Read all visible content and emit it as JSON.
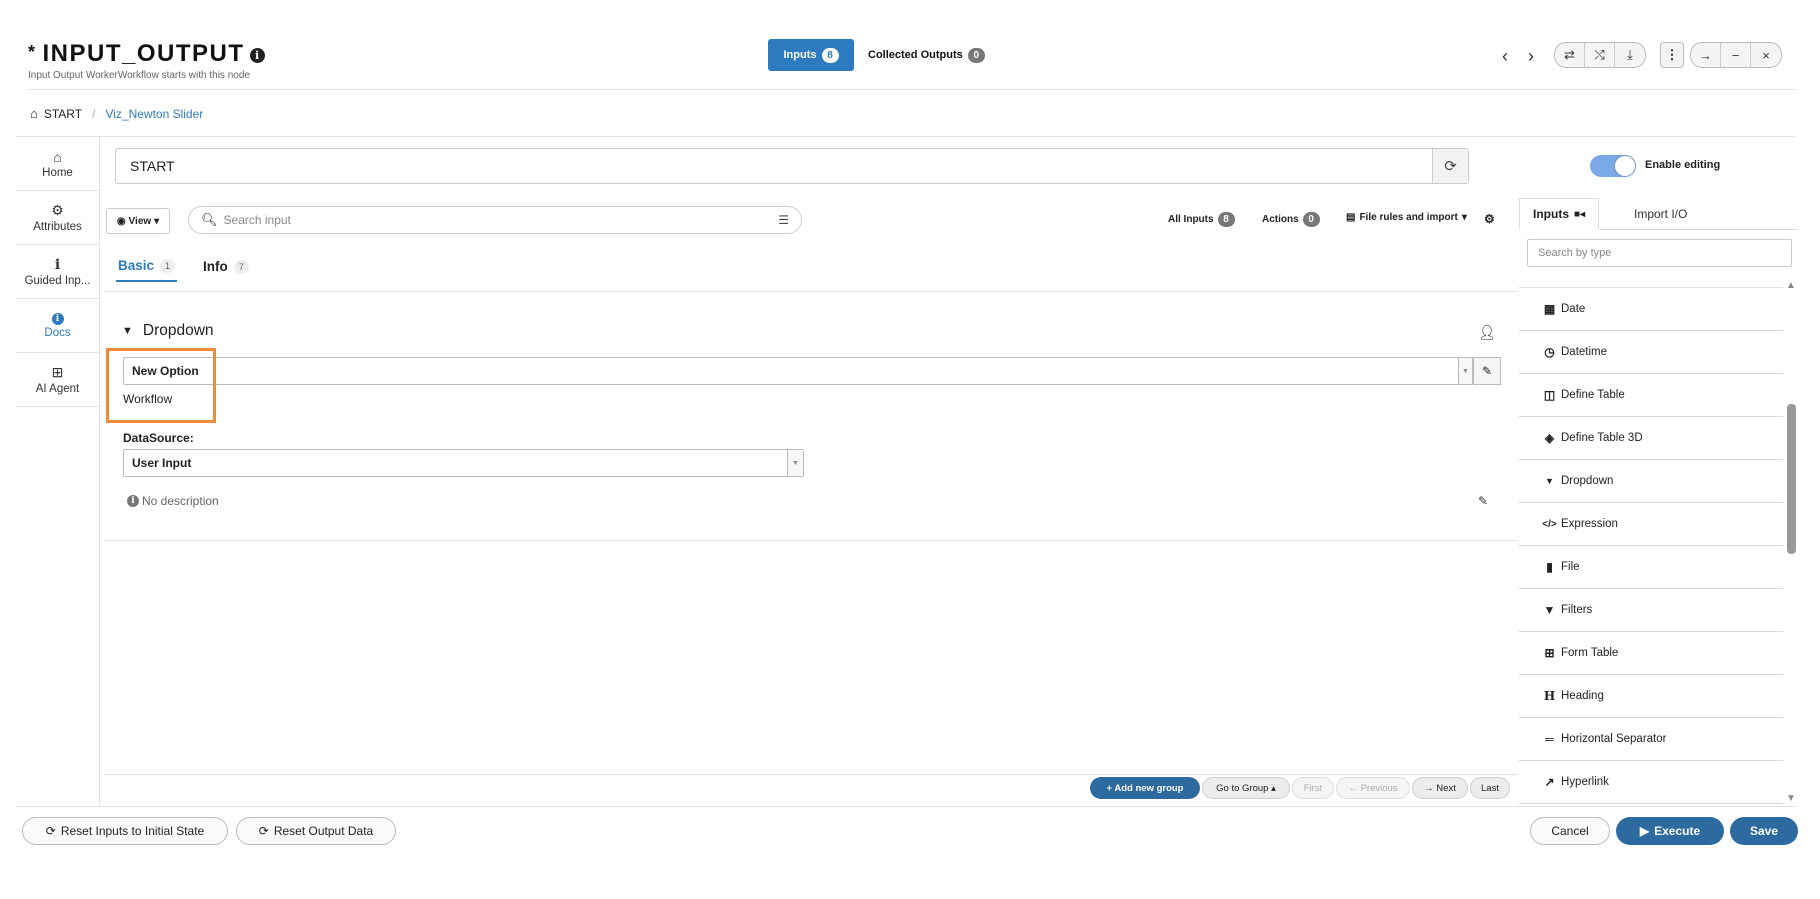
{
  "header": {
    "title": "INPUT_OUTPUT",
    "title_prefix": "*",
    "subtitle": "Input Output WorkerWorkflow starts with this node",
    "tabs": [
      {
        "label": "Inputs",
        "count": "8"
      },
      {
        "label": "Collected Outputs",
        "count": "0"
      }
    ]
  },
  "breadcrumb": {
    "root": "START",
    "current": "Viz_Newton Slider"
  },
  "left_nav": [
    {
      "label": "Home",
      "icon": "home-icon"
    },
    {
      "label": "Attributes",
      "icon": "gear-icon"
    },
    {
      "label": "Guided Inp...",
      "icon": "info-icon"
    },
    {
      "label": "Docs",
      "icon": "info-circle-icon",
      "active": true
    },
    {
      "label": "AI Agent",
      "icon": "robot-icon"
    }
  ],
  "main": {
    "start_value": "START",
    "view_label": "View",
    "search_placeholder": "Search input",
    "all_inputs_label": "All Inputs",
    "all_inputs_count": "8",
    "actions_label": "Actions",
    "actions_count": "0",
    "file_rules_label": "File rules and import",
    "subtabs": [
      {
        "label": "Basic",
        "count": "1",
        "active": true
      },
      {
        "label": "Info",
        "count": "7"
      }
    ],
    "group_title": "Dropdown",
    "dropdown_value": "New Option",
    "dropdown_sub_label": "Workflow",
    "datasource_label": "DataSource:",
    "datasource_value": "User Input",
    "no_description": "No description"
  },
  "pagination": {
    "add_group": "+ Add new group",
    "go_to_group": "Go to Group",
    "first": "First",
    "previous": "← Previous",
    "next": "→ Next",
    "last": "Last"
  },
  "right_panel": {
    "enable_editing_label": "Enable editing",
    "tabs": [
      {
        "label": "Inputs",
        "active": true
      },
      {
        "label": "Import I/O"
      }
    ],
    "search_placeholder": "Search by type",
    "types": [
      {
        "label": "Date",
        "icon": "calendar-icon"
      },
      {
        "label": "Datetime",
        "icon": "clock-icon"
      },
      {
        "label": "Define Table",
        "icon": "table-columns-icon"
      },
      {
        "label": "Define Table 3D",
        "icon": "cube-icon"
      },
      {
        "label": "Dropdown",
        "icon": "caret-down-icon"
      },
      {
        "label": "Expression",
        "icon": "code-icon"
      },
      {
        "label": "File",
        "icon": "file-icon"
      },
      {
        "label": "Filters",
        "icon": "filter-icon"
      },
      {
        "label": "Form Table",
        "icon": "table-icon"
      },
      {
        "label": "Heading",
        "icon": "heading-icon"
      },
      {
        "label": "Horizontal Separator",
        "icon": "separator-icon"
      },
      {
        "label": "Hyperlink",
        "icon": "external-link-icon"
      }
    ]
  },
  "footer": {
    "reset_inputs": "Reset Inputs to Initial State",
    "reset_output": "Reset Output Data",
    "cancel": "Cancel",
    "execute": "Execute",
    "save": "Save"
  },
  "colors": {
    "accent": "#2d7bbe",
    "button_blue": "#2d6aa0",
    "highlight": "#f08a38",
    "toggle": "#7ba8e6"
  }
}
